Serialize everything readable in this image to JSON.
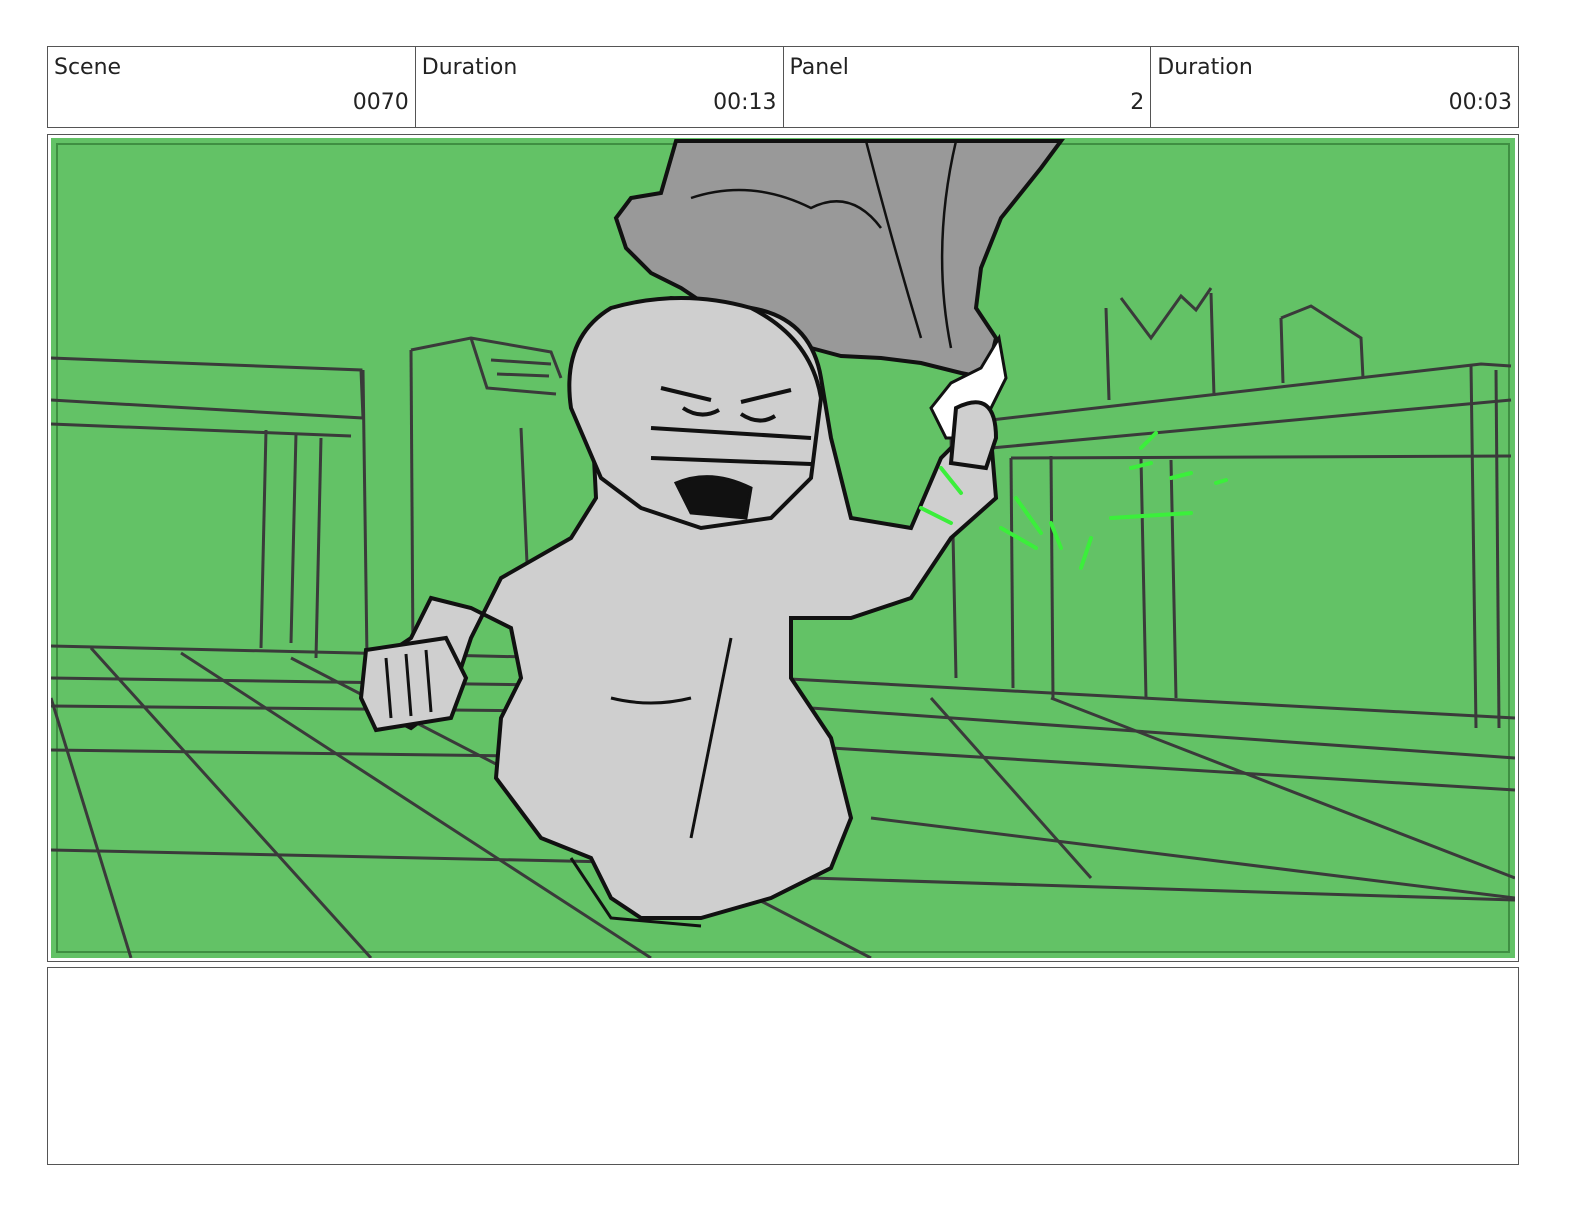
{
  "header": {
    "cells": [
      {
        "label": "Scene",
        "value": "0070"
      },
      {
        "label": "Duration",
        "value": "00:13"
      },
      {
        "label": "Panel",
        "value": "2"
      },
      {
        "label": "Duration",
        "value": "00:03"
      }
    ]
  },
  "panel": {
    "background_color": "#63c266",
    "line_color": "#3a3a3a",
    "figure_fill": "#cfcfcf",
    "cloth_fill": "#999999",
    "effect_color": "#3bef3b",
    "content": "storyboard-sketch-running-figure-with-cloth"
  },
  "notes": {
    "text": ""
  }
}
